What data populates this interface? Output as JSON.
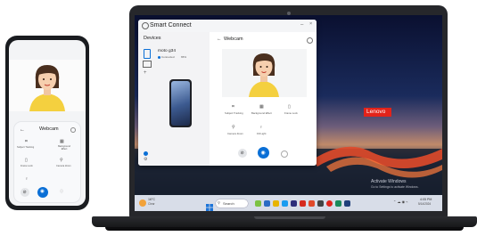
{
  "phone": {
    "card_title": "Webcam",
    "features": [
      {
        "label": "Subject Tracking",
        "icon": "subject-tracking-icon"
      },
      {
        "label": "Background Effect",
        "icon": "background-effect-icon"
      },
      {
        "label": "Frame Lock",
        "icon": "frame-lock-icon"
      },
      {
        "label": "Camera Zoom",
        "icon": "zoom-icon"
      },
      {
        "label": "",
        "icon": "bulb-icon"
      }
    ]
  },
  "app": {
    "title": "Smart Connect",
    "devices_heading": "Devices",
    "device_name": "moto g34",
    "device_status": "Connected",
    "battery": "65%",
    "panel_title": "Webcam",
    "features": [
      {
        "label": "Subject Tracking",
        "icon": "subject-tracking-icon"
      },
      {
        "label": "Background Effect",
        "icon": "background-effect-icon"
      },
      {
        "label": "Frame Lock",
        "icon": "frame-lock-icon"
      },
      {
        "label": "Camera Zoom",
        "icon": "zoom-icon"
      },
      {
        "label": "Fill Light",
        "icon": "bulb-icon"
      }
    ]
  },
  "desktop": {
    "brand": "Lenovo",
    "activate_title": "Activate Windows",
    "activate_sub": "Go to Settings to activate Windows."
  },
  "taskbar": {
    "weather_temp": "16°C",
    "weather_desc": "Clear",
    "search_placeholder": "Search",
    "time": "4:05 PM",
    "date": "5/14/2024",
    "colors": {
      "accent": "#0a6fd6",
      "brand": "#e2231a"
    }
  }
}
